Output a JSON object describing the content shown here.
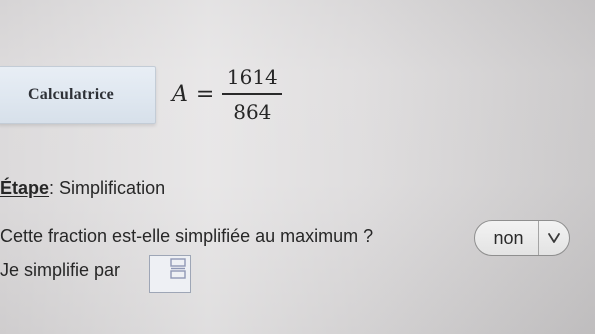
{
  "calculator": {
    "label": "Calculatrice"
  },
  "formula": {
    "variable": "A",
    "equals": "=",
    "numerator": "1614",
    "denominator": "864"
  },
  "step": {
    "prefix": "Étape",
    "separator": ": ",
    "name": "Simplification"
  },
  "question": {
    "text": "Cette fraction est-elle simplifiée au maximum ?"
  },
  "answer_select": {
    "selected": "non"
  },
  "simplify": {
    "label": "Je simplifie par"
  },
  "icons": {
    "dropdown": "chevron-down-icon",
    "input_widget": "fraction-input-icon"
  },
  "colors": {
    "button_bg": "#dfe7f0",
    "input_border": "#9ea6b6",
    "input_icon": "#8f98b5"
  }
}
